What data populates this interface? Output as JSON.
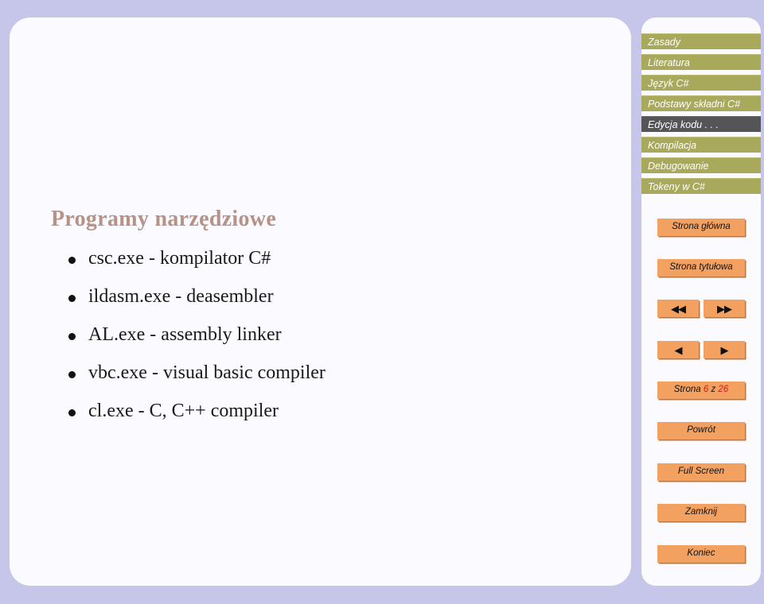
{
  "slide": {
    "title": "Programy narzędziowe",
    "bullets": [
      "csc.exe - kompilator C#",
      "ildasm.exe - deasembler",
      "AL.exe - assembly linker",
      "vbc.exe - visual basic compiler",
      "cl.exe - C, C++ compiler"
    ]
  },
  "sidebar": {
    "sections": [
      {
        "label": "Zasady",
        "current": false
      },
      {
        "label": "Literatura",
        "current": false
      },
      {
        "label": "Język C#",
        "current": false
      },
      {
        "label": "Podstawy składni C#",
        "current": false
      },
      {
        "label": "Edycja kodu . . .",
        "current": true
      },
      {
        "label": "Kompilacja",
        "current": false
      },
      {
        "label": "Debugowanie",
        "current": false
      },
      {
        "label": "Tokeny w C#",
        "current": false
      }
    ],
    "buttons": {
      "home": "Strona główna",
      "title_page": "Strona tytułowa",
      "first": "◀◀",
      "last": "▶▶",
      "prev": "◀",
      "next": "▶",
      "back": "Powrót",
      "fullscreen": "Full Screen",
      "close": "Zamknij",
      "end": "Koniec"
    },
    "page_counter": {
      "word": "Strona",
      "current": "6",
      "separator": "z",
      "total": "26"
    }
  },
  "colors": {
    "background": "#c6c6ea",
    "panel": "#fafaff",
    "nav_item": "#a9a95c",
    "nav_item_current": "#555558",
    "button": "#f2a161",
    "title_text": "#b69287",
    "page_number": "#cc2020"
  }
}
